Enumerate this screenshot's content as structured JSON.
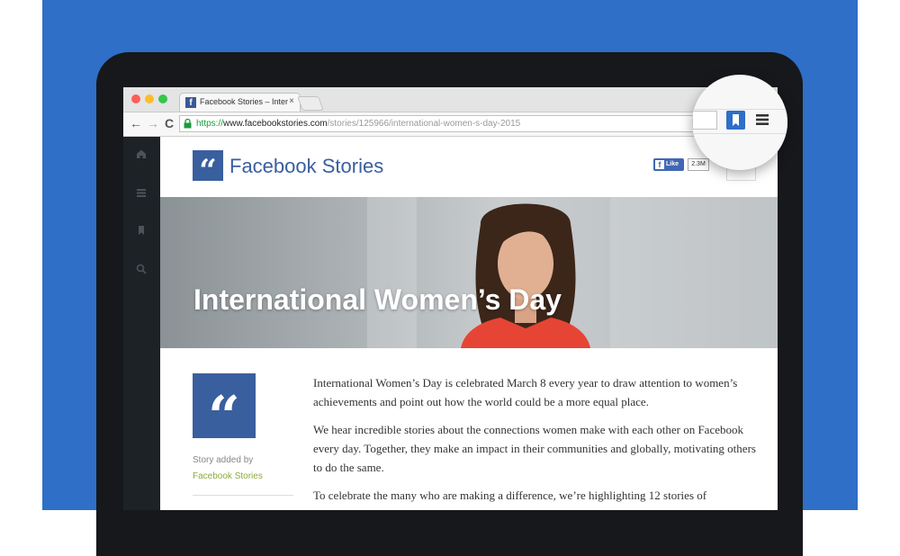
{
  "browser": {
    "tab_title": "Facebook Stories – Inter",
    "tab_close": "×",
    "url_scheme": "https://",
    "url_host": "www.facebookstories.com",
    "url_path": "/stories/125966/international-women-s-day-2015",
    "nav": {
      "back": "←",
      "forward": "→",
      "reload": "C"
    }
  },
  "site": {
    "logo_mark": "“",
    "logo_text": "Facebook Stories",
    "like_label": "Like",
    "like_count": "2.3M"
  },
  "hero": {
    "title": "International Women’s Day"
  },
  "story": {
    "added_by_label": "Story added by",
    "added_by_name": "Facebook Stories",
    "quote_mark": "“",
    "paragraphs": [
      "International Women’s Day is celebrated March 8 every year to draw attention to women’s achievements and point out how the world could be a more equal place.",
      "We hear incredible stories about the connections women make with each other on Facebook every day. Together, they make an impact in their communities and globally, motivating others to do the same.",
      "To celebrate the many who are making a difference, we’re highlighting 12 stories of"
    ]
  },
  "colors": {
    "background_blue": "#2f6fc7",
    "brand_blue": "#3a5f9e",
    "link_green": "#8aab3c"
  },
  "icons": [
    "home-icon",
    "list-icon",
    "bookmark-icon",
    "search-icon",
    "menu-icon",
    "lock-icon"
  ]
}
